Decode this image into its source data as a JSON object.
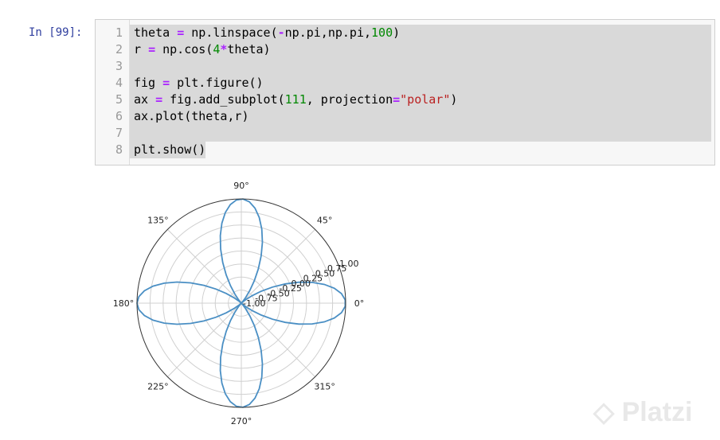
{
  "cell": {
    "prompt": "In [99]:",
    "lines": [
      {
        "n": "1",
        "tokens": [
          [
            "theta ",
            ""
          ],
          [
            "=",
            "op"
          ],
          [
            " np.linspace(",
            ""
          ],
          [
            "-",
            "op"
          ],
          [
            "np.pi,np.pi,",
            ""
          ],
          [
            "100",
            "num"
          ],
          [
            ")",
            ""
          ]
        ]
      },
      {
        "n": "2",
        "tokens": [
          [
            "r ",
            ""
          ],
          [
            "=",
            "op"
          ],
          [
            " np.cos(",
            ""
          ],
          [
            "4",
            "num"
          ],
          [
            "*",
            "op"
          ],
          [
            "theta)",
            ""
          ]
        ]
      },
      {
        "n": "3",
        "tokens": []
      },
      {
        "n": "4",
        "tokens": [
          [
            "fig ",
            ""
          ],
          [
            "=",
            "op"
          ],
          [
            " plt.figure()",
            ""
          ]
        ]
      },
      {
        "n": "5",
        "tokens": [
          [
            "ax ",
            ""
          ],
          [
            "=",
            "op"
          ],
          [
            " fig.add_subplot(",
            ""
          ],
          [
            "111",
            "num"
          ],
          [
            ", projection",
            ""
          ],
          [
            "=",
            "op"
          ],
          [
            "\"polar\"",
            "str"
          ],
          [
            ")",
            ""
          ]
        ]
      },
      {
        "n": "6",
        "tokens": [
          [
            "ax.plot(theta,r)",
            ""
          ]
        ]
      },
      {
        "n": "7",
        "tokens": []
      },
      {
        "n": "8",
        "tokens": [
          [
            "plt.show()",
            ""
          ]
        ]
      }
    ]
  },
  "chart_data": {
    "type": "line",
    "projection": "polar",
    "function": "r = cos(4*theta)",
    "theta_range": [
      -3.141592653589793,
      3.141592653589793
    ],
    "n_points": 100,
    "rlim": [
      -1,
      1
    ],
    "r_ticks": [
      "-1.00",
      "-0.75",
      "-0.50",
      "-0.25",
      "0.00",
      "0.25",
      "0.50",
      "0.75",
      "1.00"
    ],
    "r_label_angle_deg": 22.5,
    "theta_ticks": [
      "0°",
      "45°",
      "90°",
      "135°",
      "180°",
      "225°",
      "270°",
      "315°"
    ],
    "line_color": "#4a8fc4",
    "grid": true
  },
  "watermark": "Platzi"
}
